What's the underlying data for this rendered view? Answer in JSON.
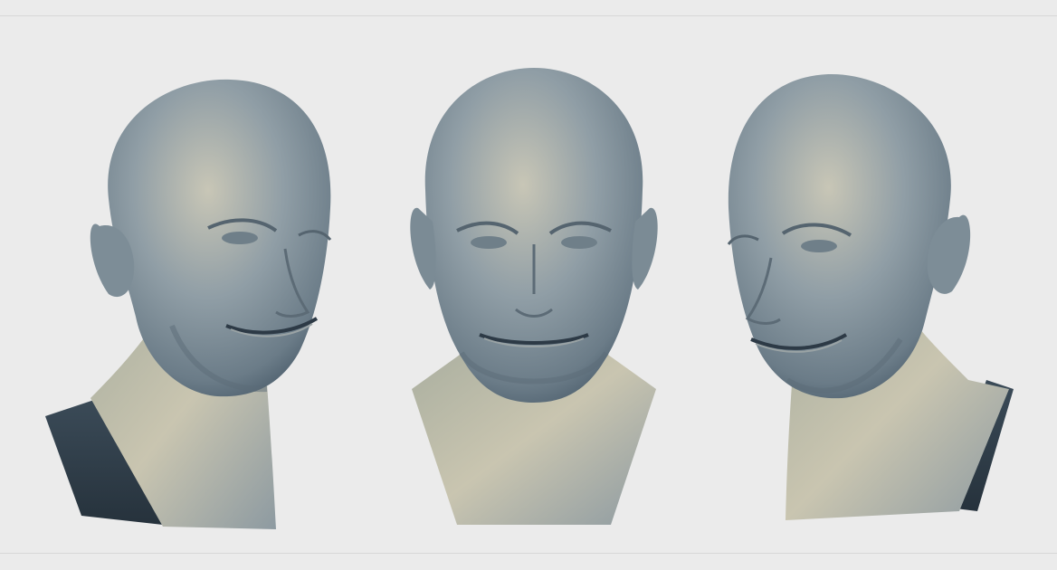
{
  "scene": {
    "background": "#ebebeb",
    "rule_color": "#d7d7d7",
    "material": {
      "base": "#8d9ba4",
      "light": "#c9c6b4",
      "mid": "#7b8b96",
      "shadow": "#334452",
      "cut": "#2d3a46"
    },
    "views": [
      {
        "name": "three-quarter-left"
      },
      {
        "name": "front"
      },
      {
        "name": "three-quarter-right"
      }
    ]
  }
}
